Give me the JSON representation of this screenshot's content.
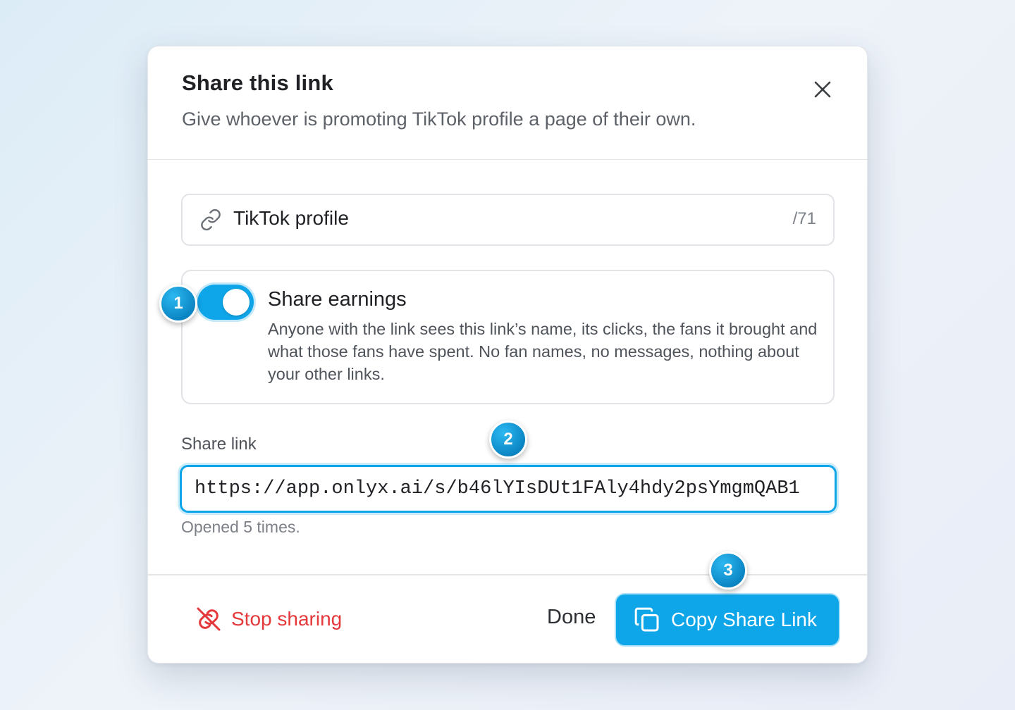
{
  "modal": {
    "title": "Share this link",
    "subtitle": "Give whoever is promoting TikTok profile a page of their own.",
    "close_icon": "close-icon"
  },
  "link_name": {
    "icon": "link-icon",
    "value": "TikTok profile",
    "counter": "/71"
  },
  "earnings": {
    "toggle_on": true,
    "title": "Share earnings",
    "description": "Anyone with the link sees this link’s name, its clicks, the fans it brought and what those fans have spent. No fan names, no messages, nothing about your other links."
  },
  "share": {
    "label": "Share link",
    "url": "https://app.onlyx.ai/s/b46lYIsDUt1FAly4hdy2psYmgmQAB1",
    "opened_text": "Opened 5 times."
  },
  "footer": {
    "stop_label": "Stop sharing",
    "stop_icon": "unlink-icon",
    "done_label": "Done",
    "copy_label": "Copy Share Link",
    "copy_icon": "copy-icon"
  },
  "badges": [
    "1",
    "2",
    "3"
  ],
  "colors": {
    "accent": "#0ea5e9",
    "danger": "#e5383b",
    "badge": "#0b86c4"
  }
}
